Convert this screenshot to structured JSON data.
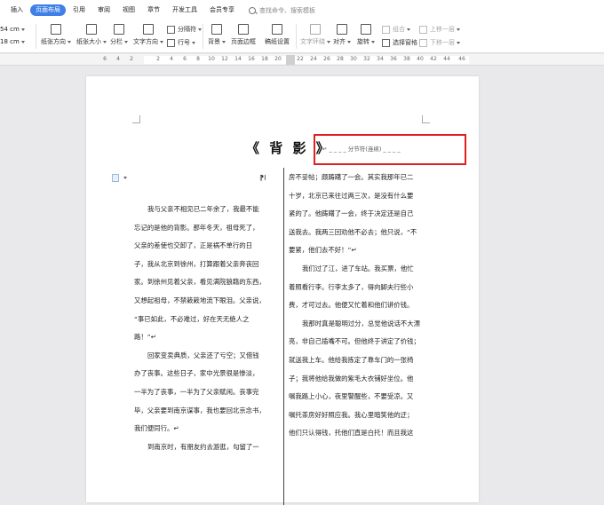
{
  "menu": {
    "tabs": [
      "插入",
      "页面布局",
      "引用",
      "审阅",
      "视图",
      "章节",
      "开发工具",
      "会员专享"
    ],
    "active": "页面布局",
    "search_placeholder": "查找命令、搜索模板"
  },
  "ribbon": {
    "margin_top": "54 cm",
    "margin_bottom": "18 cm",
    "tools": {
      "orientation": "纸张方向",
      "size": "纸张大小",
      "columns": "分栏",
      "text_direction": "文字方向",
      "line_numbers": "行号",
      "breaks": "分隔符",
      "background": "背景",
      "page_border": "页面边框",
      "manuscript": "稿纸设置",
      "wrap": "文字环绕",
      "align": "对齐",
      "rotate": "旋转",
      "group": "组合",
      "select_pane": "选择窗格",
      "bring_forward": "上移一层",
      "send_backward": "下移一层"
    }
  },
  "ruler": {
    "numbers": [
      "6",
      "4",
      "2",
      "2",
      "4",
      "6",
      "8",
      "10",
      "12",
      "14",
      "16",
      "18",
      "20",
      "22",
      "24",
      "26",
      "28",
      "30",
      "32",
      "34",
      "36",
      "38",
      "40",
      "42",
      "44",
      "46"
    ]
  },
  "document": {
    "title": "《 背 影 》",
    "section_break": "↵ _ _ _ _ 分节符(连续) _ _ _ _",
    "left_column": [
      "我与父亲不相见已二年余了，我最不能",
      "忘记的是他的背影。那年冬天，祖母死了，",
      "父亲的差使也交卸了，正是祸不单行的日",
      "子，我从北京到徐州，打算跟着父亲奔丧回",
      "家。到徐州见着父亲，看见满院狼藉的东西，",
      "又想起祖母，不禁簌簌地流下眼泪。父亲说，",
      "“事已如此，不必难过，好在天无绝人之",
      "路！”↵",
      "回家变卖典质，父亲还了亏空；又借钱",
      "办了丧事。这些日子，家中光景很是惨淡，",
      "一半为了丧事，一半为了父亲赋闲。丧事完",
      "毕，父亲要到南京谋事，我也要回北京念书，",
      "我们便同行。↵",
      "到南京时，有朋友约去游逛，勾留了一"
    ],
    "right_column": [
      "房不妥帖；颇踌躇了一会。其实我那年已二",
      "十岁，北京已来往过两三次，是没有什么要",
      "紧的了。他踌躇了一会，终于决定还是自己",
      "送我去。我两三回劝他不必去；他只说，“不",
      "要紧，他们去不好！”↵",
      "我们过了江，进了车站。我买票，他忙",
      "着照看行李。行李太多了，得向脚夫行些小",
      "费，才可过去。他便又忙着和他们讲价钱。",
      "我那时真是聪明过分，总觉他说话不大漂",
      "亮，非自己插嘴不可。但他终于讲定了价钱；",
      "就送我上车。他给我拣定了靠车门的一张椅",
      "子；我将他给我做的紫毛大衣铺好坐位。他",
      "嘱我路上小心，夜里警醒些，不要受凉。又",
      "嘱托茶房好好照应我。我心里暗笑他的迂；",
      "他们只认得钱，托他们直是白托！而且我这"
    ]
  },
  "colors": {
    "accent": "#3f7fe8",
    "highlight_box": "#e02020"
  }
}
